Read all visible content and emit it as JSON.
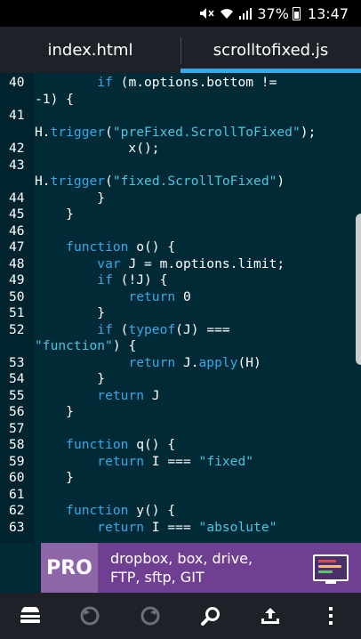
{
  "status_bar": {
    "battery": "37%",
    "time": "13:47"
  },
  "tabs": [
    {
      "label": "index.html",
      "active": false
    },
    {
      "label": "scrolltofixed.js",
      "active": true
    }
  ],
  "editor": {
    "lines": [
      {
        "num": "40",
        "text": "        if (m.options.bottom !="
      },
      {
        "num": "",
        "text": "-1) {"
      },
      {
        "num": "41",
        "text": ""
      },
      {
        "num": "",
        "text": "H.trigger(\"preFixed.ScrollToFixed\");"
      },
      {
        "num": "42",
        "text": "            x();"
      },
      {
        "num": "43",
        "text": ""
      },
      {
        "num": "",
        "text": "H.trigger(\"fixed.ScrollToFixed\")"
      },
      {
        "num": "44",
        "text": "        }"
      },
      {
        "num": "45",
        "text": "    }"
      },
      {
        "num": "46",
        "text": ""
      },
      {
        "num": "47",
        "text": "    function o() {"
      },
      {
        "num": "48",
        "text": "        var J = m.options.limit;"
      },
      {
        "num": "49",
        "text": "        if (!J) {"
      },
      {
        "num": "50",
        "text": "            return 0"
      },
      {
        "num": "51",
        "text": "        }"
      },
      {
        "num": "52",
        "text": "        if (typeof(J) ==="
      },
      {
        "num": "",
        "text": "\"function\") {"
      },
      {
        "num": "53",
        "text": "            return J.apply(H)"
      },
      {
        "num": "54",
        "text": "        }"
      },
      {
        "num": "55",
        "text": "        return J"
      },
      {
        "num": "56",
        "text": "    }"
      },
      {
        "num": "57",
        "text": ""
      },
      {
        "num": "58",
        "text": "    function q() {"
      },
      {
        "num": "59",
        "text": "        return I === \"fixed\""
      },
      {
        "num": "60",
        "text": "    }"
      },
      {
        "num": "61",
        "text": ""
      },
      {
        "num": "62",
        "text": "    function y() {"
      },
      {
        "num": "63",
        "text": "        return I === \"absolute\""
      }
    ]
  },
  "ad": {
    "badge": "PRO",
    "line1": "dropbox, box, drive,",
    "line2": "FTP, sftp, GIT"
  },
  "colors": {
    "editor_bg": "#002b36",
    "keyword": "#3aa8e8",
    "string": "#4fc3e0",
    "tab_indicator": "#3aa8e8",
    "ad_bg": "#6f3f91"
  },
  "bottom_bar": [
    {
      "icon": "keyboard-icon"
    },
    {
      "icon": "undo-icon"
    },
    {
      "icon": "redo-icon"
    },
    {
      "icon": "search-icon"
    },
    {
      "icon": "upload-icon"
    },
    {
      "icon": "more-icon"
    }
  ]
}
